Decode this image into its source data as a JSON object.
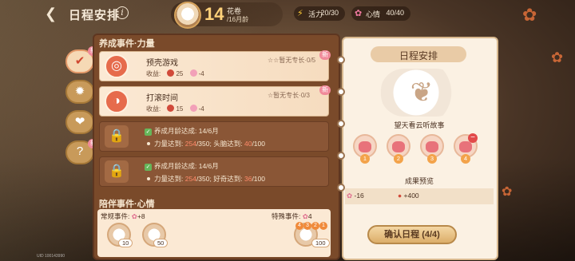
{
  "header": {
    "title": "日程安排",
    "pet": {
      "age": "14",
      "name": "花卷",
      "month": "/16月龄"
    },
    "energy": {
      "label": "活力",
      "value": "20/30"
    },
    "mood": {
      "label": "心情",
      "value": "40/40"
    }
  },
  "side_tabs": [
    {
      "icon": "check-icon",
      "new": "新"
    },
    {
      "icon": "lightbulb-icon",
      "new": ""
    },
    {
      "icon": "heart-icon",
      "new": ""
    },
    {
      "icon": "question-icon",
      "new": "新"
    }
  ],
  "main": {
    "section_title": "养成事件·力量",
    "events": [
      {
        "name": "预壳游戏",
        "speciality": "暂无专长·0/5",
        "gain_label": "收益:",
        "gain_red": "25",
        "gain_pink": "-4",
        "new": "新"
      },
      {
        "name": "打滚时间",
        "speciality": "暂无专长·0/3",
        "gain_label": "收益:",
        "gain_red": "15",
        "gain_pink": "-4",
        "new": "新"
      }
    ],
    "locked": [
      {
        "age_req": "养成月龄达成: 14/6月",
        "req_label1": "力量达到:",
        "req_val1": "254",
        "req_max1": "/350;",
        "req_label2": "头脑达到:",
        "req_val2": "40",
        "req_max2": "/100"
      },
      {
        "age_req": "养成月龄达成: 14/6月",
        "req_label1": "力量达到:",
        "req_val1": "254",
        "req_max1": "/350;",
        "req_label2": "好奇达到:",
        "req_val2": "36",
        "req_max2": "/100"
      }
    ],
    "companion": {
      "title": "陪伴事件·心情",
      "regular_label": "常规事件:",
      "regular_count": "+8",
      "special_label": "特殊事件:",
      "special_count": "4",
      "slot_badges": [
        "10",
        "50",
        "100"
      ],
      "seq": [
        "4",
        "3",
        "2",
        "1"
      ]
    }
  },
  "right": {
    "title": "日程安排",
    "caption": "望天看云听故事",
    "slots": [
      "1",
      "2",
      "3",
      "4"
    ],
    "preview_label": "成果预览",
    "preview_items": [
      "-16",
      "+400"
    ],
    "confirm": "确认日程 (4/4)"
  },
  "uid": "UID 100143990",
  "colors": {
    "accent": "#e66b4c",
    "panel": "#7a4a2a",
    "paper": "#fbf1e3"
  }
}
